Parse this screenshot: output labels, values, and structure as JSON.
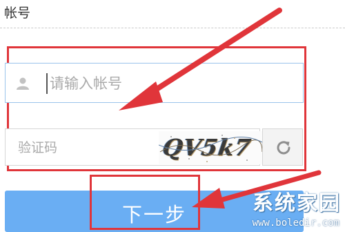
{
  "header": {
    "title": "帐号"
  },
  "account": {
    "placeholder": "请输入帐号",
    "value": ""
  },
  "captcha": {
    "placeholder": "验证码",
    "value": "",
    "image_text": "QV5k7"
  },
  "next_button": {
    "label": "下一步"
  },
  "watermark": {
    "brand": "系统家园",
    "url": "www.boledir.com"
  },
  "colors": {
    "annotation_red": "#e0353a",
    "button_blue": "#6aaef3",
    "focus_border": "#9bc4ec"
  },
  "icons": {
    "user": "user-icon",
    "refresh": "refresh-icon"
  }
}
